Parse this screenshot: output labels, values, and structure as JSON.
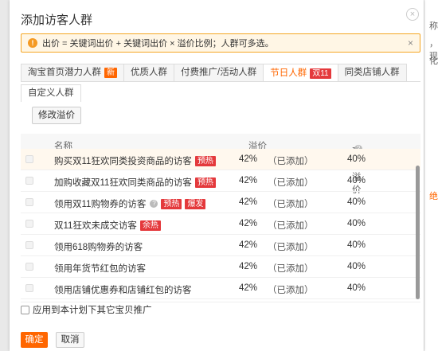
{
  "dialog": {
    "title": "添加访客人群",
    "close_icon": "×"
  },
  "notice": {
    "icon": "!",
    "text": "出价 = 关键词出价 + 关键词出价 × 溢价比例；人群可多选。",
    "close": "×"
  },
  "tabs": [
    {
      "label": "淘宝首页潜力人群",
      "badge": "新",
      "badge_color": "#ff6600",
      "active": false
    },
    {
      "label": "优质人群",
      "badge": "",
      "active": false
    },
    {
      "label": "付费推广/活动人群",
      "badge": "",
      "active": false
    },
    {
      "label": "节日人群",
      "badge": "双11",
      "badge_color": "#e4393c",
      "active": true
    },
    {
      "label": "同类店铺人群",
      "badge": "",
      "active": false
    }
  ],
  "tab_row2": "自定义人群",
  "modify_button": "修改溢价",
  "table": {
    "headers": {
      "name": "名称",
      "premium": "溢价",
      "suggested": "建议溢价"
    },
    "rows": [
      {
        "name": "购买双11狂欢同类投资商品的访客",
        "tags": [
          "预热"
        ],
        "premium": "42%",
        "status": "（已添加）",
        "suggested": "40%",
        "ghost": true
      },
      {
        "name": "加购收藏双11狂欢同类商品的访客",
        "tags": [
          "预热"
        ],
        "premium": "42%",
        "status": "（已添加）",
        "suggested": "40%"
      },
      {
        "name": "领用双11购物券的访客",
        "help": true,
        "tags": [
          "预热",
          "爆发"
        ],
        "premium": "42%",
        "status": "（已添加）",
        "suggested": "40%"
      },
      {
        "name": "双11狂欢未成交访客",
        "tags": [
          "余热"
        ],
        "premium": "42%",
        "status": "（已添加）",
        "suggested": "40%"
      },
      {
        "name": "领用618购物券的访客",
        "tags": [],
        "premium": "42%",
        "status": "（已添加）",
        "suggested": "40%"
      },
      {
        "name": "领用年货节红包的访客",
        "tags": [],
        "premium": "42%",
        "status": "（已添加）",
        "suggested": "40%"
      },
      {
        "name": "领用店铺优惠券和店铺红包的访客",
        "tags": [],
        "premium": "42%",
        "status": "（已添加）",
        "suggested": "40%"
      }
    ]
  },
  "apply_checkbox": "应用到本计划下其它宝贝推广",
  "buttons": {
    "ok": "确定",
    "cancel": "取消"
  },
  "background_right": [
    "称",
    "，现",
    "化",
    "绝"
  ]
}
